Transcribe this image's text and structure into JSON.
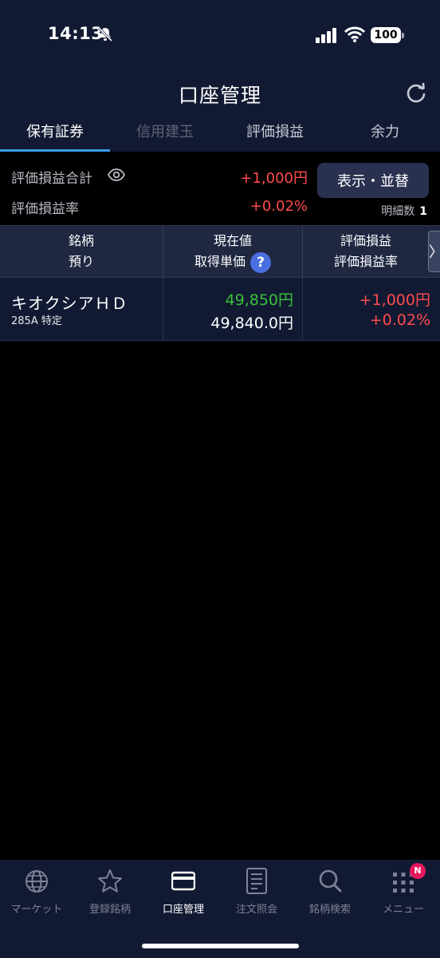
{
  "status_bar": {
    "time": "14:13",
    "battery": "100",
    "icons": [
      "bell-slash-icon",
      "signal-icon",
      "wifi-icon",
      "battery-icon"
    ]
  },
  "header": {
    "title": "口座管理",
    "refresh_icon": "refresh-icon"
  },
  "tabs": [
    {
      "label": "保有証券",
      "state": "active"
    },
    {
      "label": "信用建玉",
      "state": "disabled"
    },
    {
      "label": "評価損益",
      "state": "normal"
    },
    {
      "label": "余力",
      "state": "normal"
    }
  ],
  "summary": {
    "total_label": "評価損益合計",
    "total_value": "+1,000円",
    "rate_label": "評価損益率",
    "rate_value": "+0.02%",
    "sort_button": "表示・並替",
    "detail_count_label": "明細数",
    "detail_count": "1"
  },
  "table": {
    "headers": [
      {
        "line1": "銘柄",
        "line2": "預り"
      },
      {
        "line1": "現在値",
        "line2": "取得単価"
      },
      {
        "line1": "評価損益",
        "line2": "評価損益率"
      }
    ],
    "help_symbol": "?",
    "scroll_symbol": "〉",
    "rows": [
      {
        "name": "キオクシアＨＤ",
        "code": "285A 特定",
        "current_price": "49,850円",
        "acquisition_price": "49,840.0円",
        "profit_loss": "+1,000円",
        "profit_loss_rate": "+0.02%"
      }
    ]
  },
  "bottom_nav": {
    "items": [
      {
        "label": "マーケット",
        "icon": "globe-icon"
      },
      {
        "label": "登録銘柄",
        "icon": "star-icon"
      },
      {
        "label": "口座管理",
        "icon": "card-icon",
        "active": true
      },
      {
        "label": "注文照会",
        "icon": "document-icon"
      },
      {
        "label": "銘柄検索",
        "icon": "search-icon"
      },
      {
        "label": "メニュー",
        "icon": "grid-menu-icon",
        "badge": "N"
      }
    ]
  },
  "colors": {
    "header_bg": "#121a33",
    "accent_blue": "#3d9be9",
    "profit_red": "#ff4b4b",
    "price_green": "#37c237",
    "badge_pink": "#e8175d"
  }
}
